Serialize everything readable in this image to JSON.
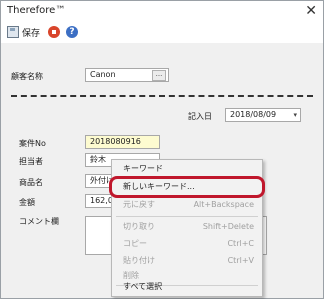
{
  "window": {
    "title": "Therefore™",
    "close_glyph": "✕"
  },
  "toolbar": {
    "save_label": "保存",
    "help_glyph": "?"
  },
  "form": {
    "customer_label": "顧客名称",
    "customer_value": "Canon",
    "lookup_glyph": "...",
    "date_label": "記入日",
    "date_value": "2018/08/09",
    "date_dropdown_glyph": "▾",
    "case_no_label": "案件No",
    "case_no_value": "2018080916",
    "person_label": "担当者",
    "person_value": "鈴木",
    "product_label": "商品名",
    "product_value": "外付けハード",
    "amount_label": "金額",
    "amount_value": "162,000.00",
    "comment_label": "コメント欄"
  },
  "context_menu": {
    "items": [
      {
        "label": "キーワード",
        "shortcut": "",
        "state": "enabled"
      },
      {
        "label": "新しいキーワード...",
        "shortcut": "",
        "state": "enabled"
      },
      {
        "label": "元に戻す",
        "shortcut": "Alt+Backspace",
        "state": "disabled"
      },
      {
        "label": "切り取り",
        "shortcut": "Shift+Delete",
        "state": "disabled"
      },
      {
        "label": "コピー",
        "shortcut": "Ctrl+C",
        "state": "disabled"
      },
      {
        "label": "貼り付け",
        "shortcut": "Ctrl+V",
        "state": "disabled"
      },
      {
        "label": "削除",
        "shortcut": "",
        "state": "disabled"
      },
      {
        "label": "すべて選択",
        "shortcut": "",
        "state": "enabled"
      }
    ],
    "highlight_color": "#c0172c"
  },
  "colors": {
    "stop_icon": "#d9452b",
    "help_icon": "#3c6fc4",
    "required_field_bg": "#fdfbd0"
  }
}
